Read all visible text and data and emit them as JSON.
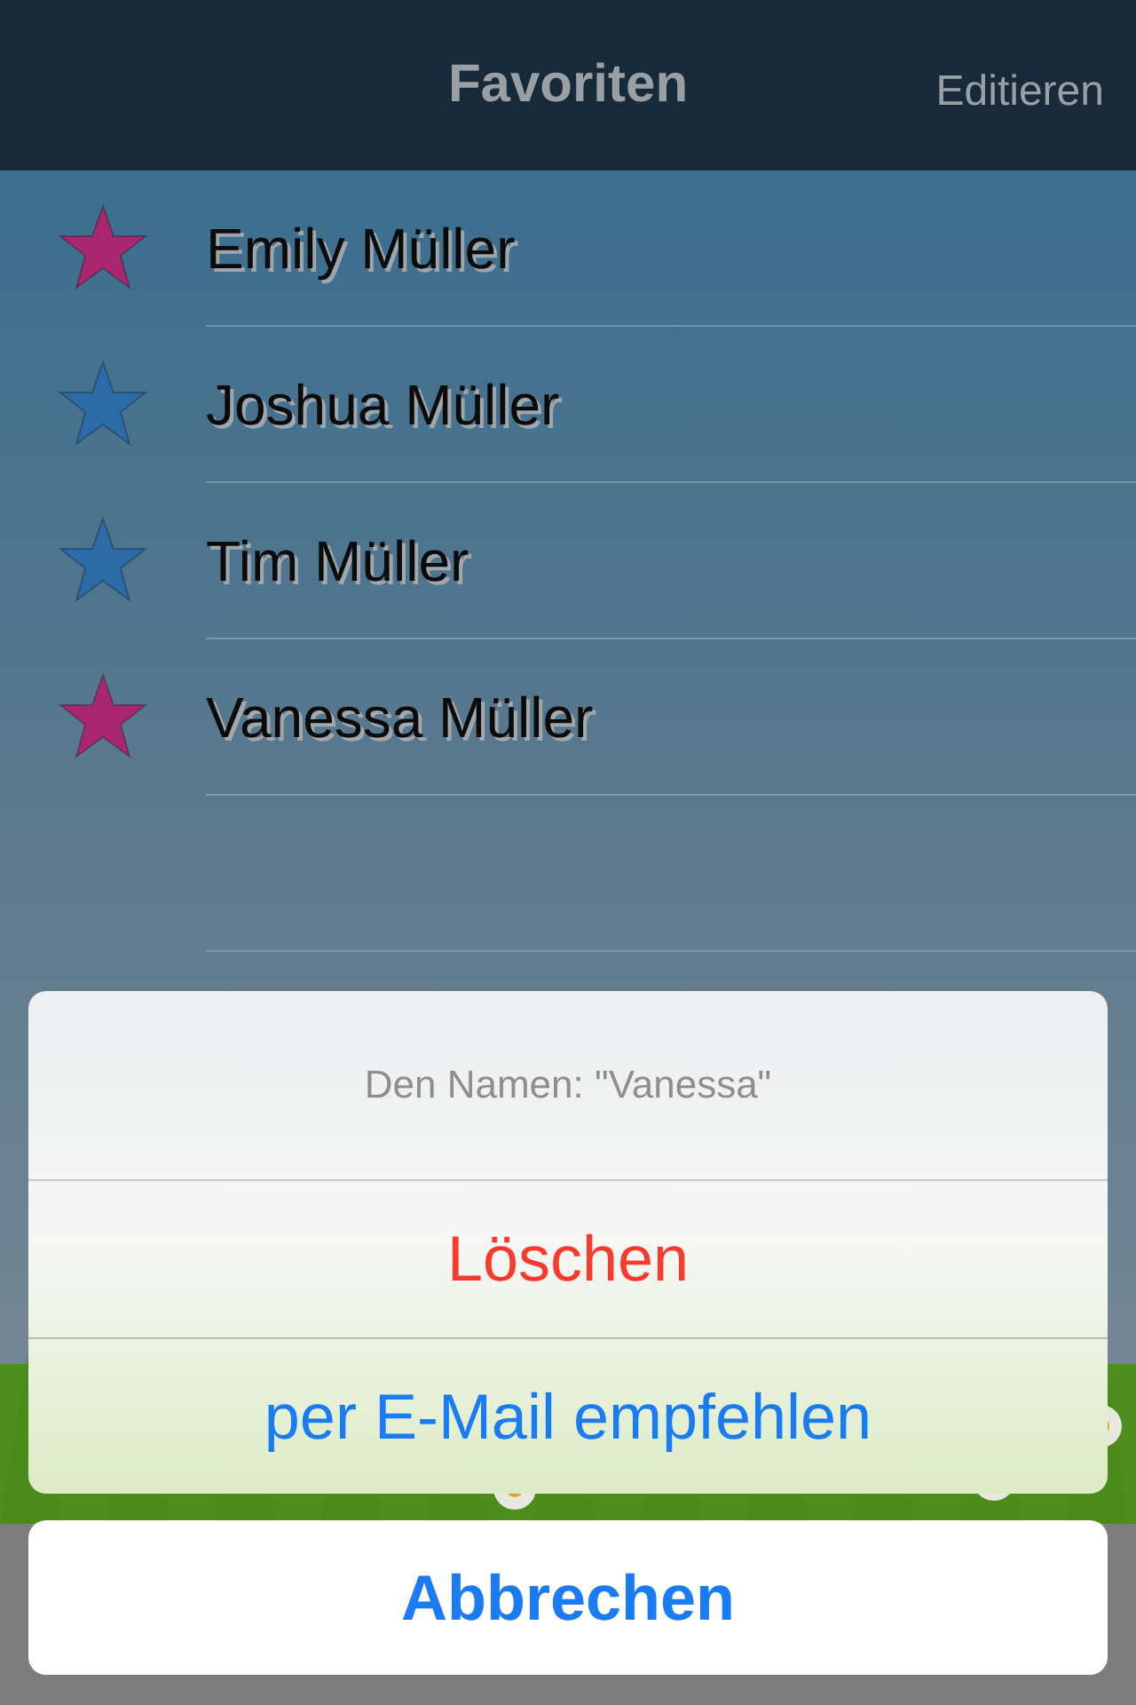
{
  "nav_bar": {
    "title": "Favoriten",
    "edit_button": "Editieren"
  },
  "favorites": [
    {
      "name": "Emily Müller",
      "color": "#a8276e"
    },
    {
      "name": "Joshua Müller",
      "color": "#2c6aa8"
    },
    {
      "name": "Tim Müller",
      "color": "#2c6aa8"
    },
    {
      "name": "Vanessa Müller",
      "color": "#a8276e"
    }
  ],
  "action_sheet": {
    "title": "Den Namen: \"Vanessa\"",
    "actions": [
      {
        "label": "Löschen",
        "kind": "destructive"
      },
      {
        "label": "per E-Mail empfehlen",
        "kind": "default"
      }
    ],
    "cancel": "Abbrechen"
  }
}
